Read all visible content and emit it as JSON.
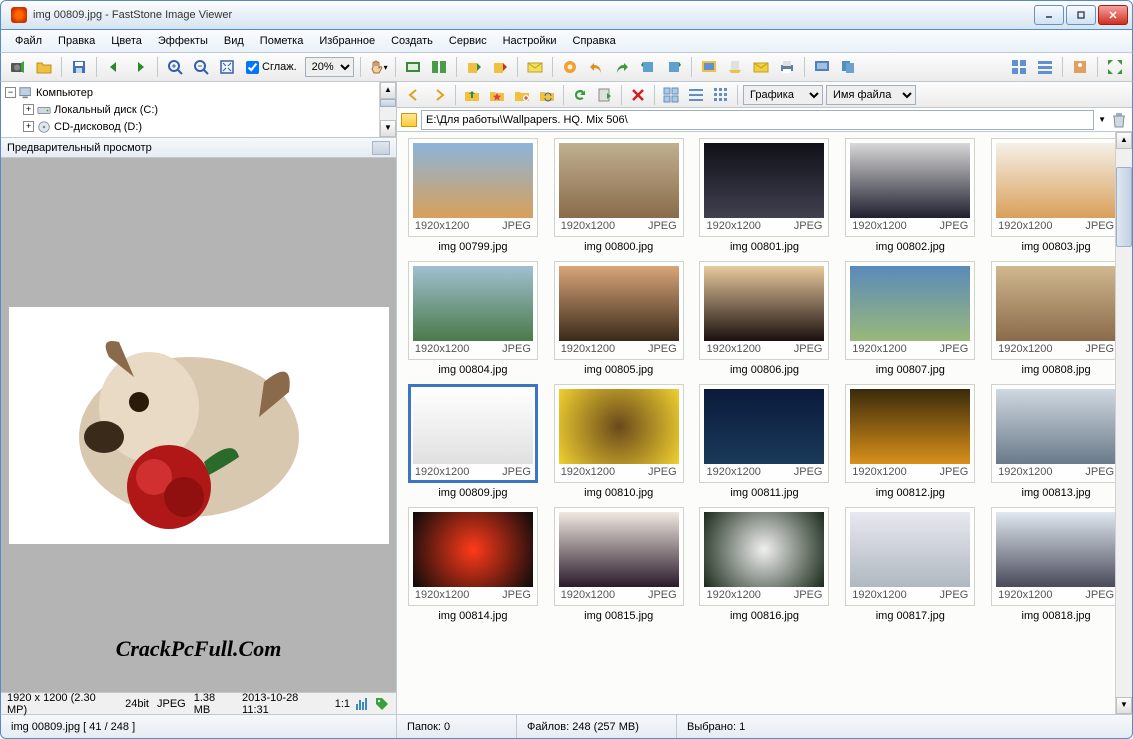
{
  "title": "img 00809.jpg  -  FastStone Image Viewer",
  "menu": [
    "Файл",
    "Правка",
    "Цвета",
    "Эффекты",
    "Вид",
    "Пометка",
    "Избранное",
    "Создать",
    "Сервис",
    "Настройки",
    "Справка"
  ],
  "toolbar": {
    "smooth_label": "Сглаж.",
    "zoom_value": "20%"
  },
  "tree": {
    "root": "Компьютер",
    "items": [
      "Локальный диск (C:)",
      "CD-дисковод (D:)"
    ]
  },
  "preview": {
    "header": "Предварительный просмотр",
    "watermark": "CrackPcFull.Com",
    "status_res": "1920 x 1200 (2.30 MP)",
    "status_bit": "24bit",
    "status_fmt": "JPEG",
    "status_size": "1.38 MB",
    "status_date": "2013-10-28 11:31",
    "status_ratio": "1:1"
  },
  "browser": {
    "dropdown_view": "Графика",
    "dropdown_sort": "Имя файла",
    "path": "E:\\Для работы\\Wallpapers. HQ. Mix 506\\"
  },
  "thumbs": [
    {
      "name": "img 00799.jpg",
      "res": "1920x1200",
      "fmt": "JPEG",
      "bg": "linear-gradient(#8bb5d9,#d9a05a)"
    },
    {
      "name": "img 00800.jpg",
      "res": "1920x1200",
      "fmt": "JPEG",
      "bg": "linear-gradient(#c0b090,#8a6b4a)"
    },
    {
      "name": "img 00801.jpg",
      "res": "1920x1200",
      "fmt": "JPEG",
      "bg": "linear-gradient(#101018,#404050)"
    },
    {
      "name": "img 00802.jpg",
      "res": "1920x1200",
      "fmt": "JPEG",
      "bg": "linear-gradient(#d8d8d8,#202030)"
    },
    {
      "name": "img 00803.jpg",
      "res": "1920x1200",
      "fmt": "JPEG",
      "bg": "linear-gradient(#f5f0e8,#d9a05a)"
    },
    {
      "name": "img 00804.jpg",
      "res": "1920x1200",
      "fmt": "JPEG",
      "bg": "linear-gradient(#a0c0d0,#4a7a4a)"
    },
    {
      "name": "img 00805.jpg",
      "res": "1920x1200",
      "fmt": "JPEG",
      "bg": "linear-gradient(#d9a579,#3a2a1a)"
    },
    {
      "name": "img 00806.jpg",
      "res": "1920x1200",
      "fmt": "JPEG",
      "bg": "linear-gradient(#e8c99c,#1a1010)"
    },
    {
      "name": "img 00807.jpg",
      "res": "1920x1200",
      "fmt": "JPEG",
      "bg": "linear-gradient(#5a8aba,#9ab87a)"
    },
    {
      "name": "img 00808.jpg",
      "res": "1920x1200",
      "fmt": "JPEG",
      "bg": "linear-gradient(#d0b890,#8a6a4a)"
    },
    {
      "name": "img 00809.jpg",
      "res": "1920x1200",
      "fmt": "JPEG",
      "bg": "linear-gradient(#ffffff,#e0e0e0)",
      "selected": true
    },
    {
      "name": "img 00810.jpg",
      "res": "1920x1200",
      "fmt": "JPEG",
      "bg": "radial-gradient(circle,#6a4a1a,#f0d030)"
    },
    {
      "name": "img 00811.jpg",
      "res": "1920x1200",
      "fmt": "JPEG",
      "bg": "linear-gradient(#0a1a3a,#1a3a5a)"
    },
    {
      "name": "img 00812.jpg",
      "res": "1920x1200",
      "fmt": "JPEG",
      "bg": "linear-gradient(#3a2a0a,#d9901a)"
    },
    {
      "name": "img 00813.jpg",
      "res": "1920x1200",
      "fmt": "JPEG",
      "bg": "linear-gradient(#d0d8e0,#6a7a8a)"
    },
    {
      "name": "img 00814.jpg",
      "res": "1920x1200",
      "fmt": "JPEG",
      "bg": "radial-gradient(circle,#ff3a1a,#0a0a0a)"
    },
    {
      "name": "img 00815.jpg",
      "res": "1920x1200",
      "fmt": "JPEG",
      "bg": "linear-gradient(#f0e8e0,#2a1a2a)"
    },
    {
      "name": "img 00816.jpg",
      "res": "1920x1200",
      "fmt": "JPEG",
      "bg": "radial-gradient(circle,#f0f0f0,#1a2a1a)"
    },
    {
      "name": "img 00817.jpg",
      "res": "1920x1200",
      "fmt": "JPEG",
      "bg": "linear-gradient(#e8e8f0,#b0b8c0)"
    },
    {
      "name": "img 00818.jpg",
      "res": "1920x1200",
      "fmt": "JPEG",
      "bg": "linear-gradient(#e0e8f0,#4a4a5a)"
    }
  ],
  "status": {
    "left": "img 00809.jpg  [ 41 / 248 ]",
    "folders": "Папок: 0",
    "files": "Файлов: 248 (257 MB)",
    "selected": "Выбрано: 1"
  }
}
